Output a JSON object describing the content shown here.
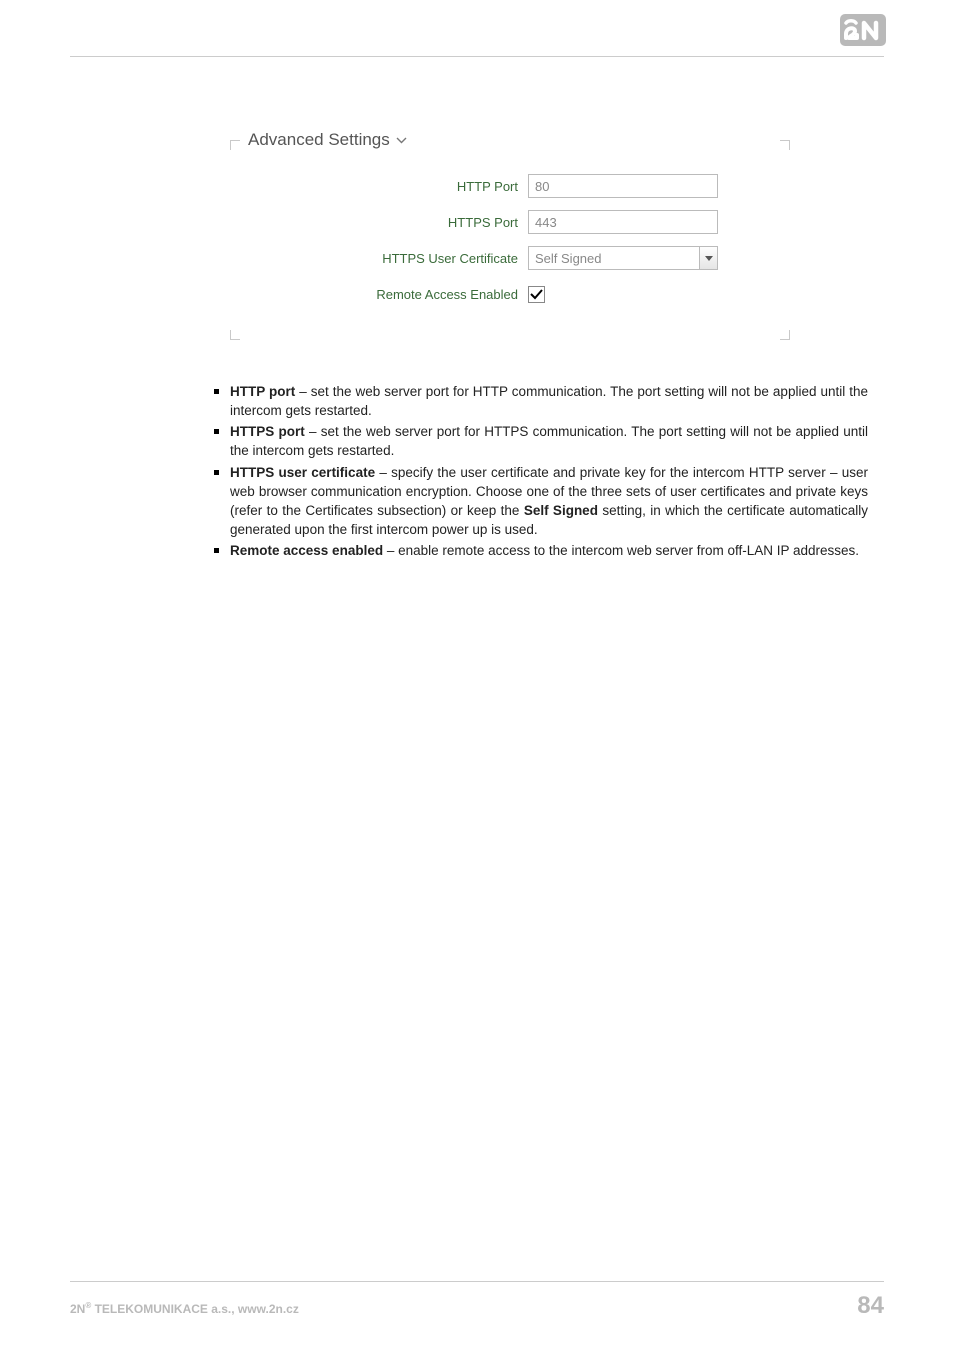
{
  "logo": {
    "name": "2N"
  },
  "panel": {
    "title": "Advanced Settings",
    "rows": {
      "http_port": {
        "label": "HTTP Port",
        "value": "80"
      },
      "https_port": {
        "label": "HTTPS Port",
        "value": "443"
      },
      "https_cert": {
        "label": "HTTPS User Certificate",
        "value": "Self Signed"
      },
      "remote": {
        "label": "Remote Access Enabled",
        "checked": true
      }
    }
  },
  "bullets": [
    {
      "term": "HTTP port",
      "rest": " – set the web server port for HTTP communication. The port setting will not be applied until the intercom gets restarted."
    },
    {
      "term": "HTTPS port",
      "rest": " – set the web server port for HTTPS communication. The port setting will not be applied until the intercom gets restarted."
    },
    {
      "term": "HTTPS user certificate",
      "rest": " – specify the user certificate and private key for the intercom HTTP server – user web browser communication encryption. Choose one of the three sets of user certificates and private keys (refer to the Certificates subsection) or keep the ",
      "bold2": "Self Signed",
      "rest2": " setting, in which the certificate automatically generated upon the first intercom power up is used."
    },
    {
      "term": "Remote access enabled",
      "rest": " – enable remote access to the intercom web server from off-LAN IP addresses."
    }
  ],
  "footer": {
    "company_prefix": "2N",
    "company_sup": "®",
    "company_rest": " TELEKOMUNIKACE a.s., www.2n.cz",
    "page": "84"
  }
}
